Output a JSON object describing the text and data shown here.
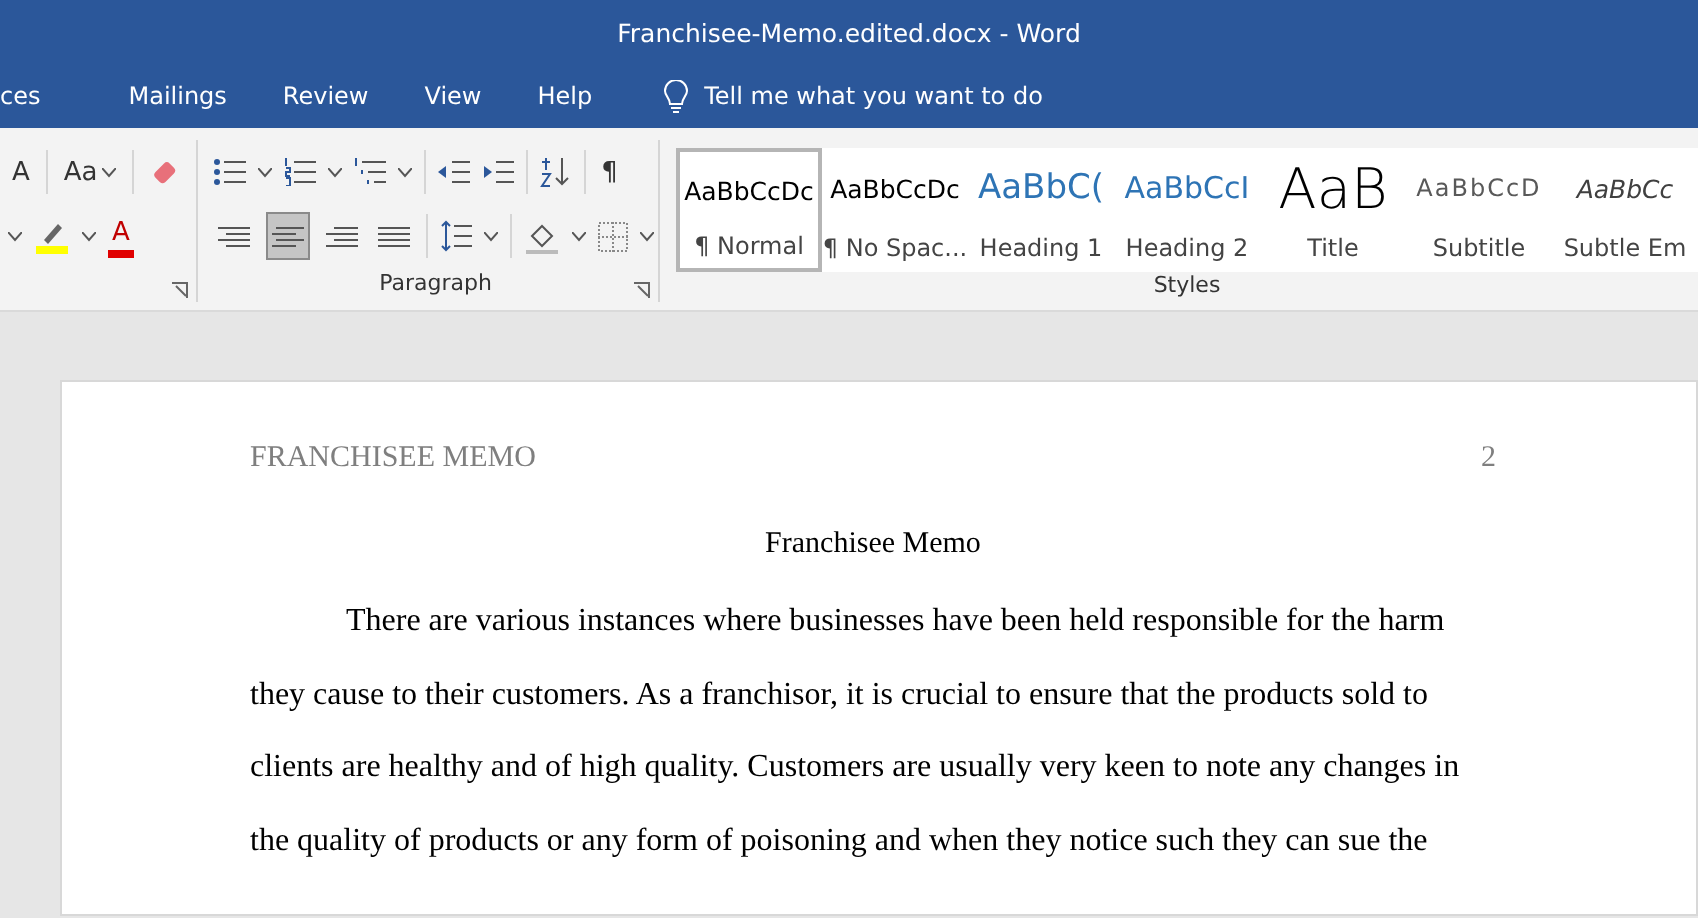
{
  "window": {
    "title": "Franchisee-Memo.edited.docx  -  Word"
  },
  "menu_tabs": [
    {
      "label": "ces",
      "selected": false
    },
    {
      "label": "Mailings",
      "selected": false
    },
    {
      "label": "Review",
      "selected": false
    },
    {
      "label": "View",
      "selected": false
    },
    {
      "label": "Help",
      "selected": false
    }
  ],
  "tell_me": {
    "placeholder": "Tell me what you want to do"
  },
  "font_group": {
    "grow_font": "A",
    "change_case": "Aa",
    "font_color": "A"
  },
  "paragraph_group": {
    "label": "Paragraph",
    "pilcrow": "¶",
    "alignment": [
      {
        "kind": "left",
        "selected": false
      },
      {
        "kind": "center",
        "selected": true
      },
      {
        "kind": "right",
        "selected": false
      },
      {
        "kind": "justify",
        "selected": false
      }
    ]
  },
  "styles_group": {
    "label": "Styles",
    "items": [
      {
        "preview": "AaBbCcDc",
        "name": "¶ Normal",
        "kind": "normal",
        "selected": true
      },
      {
        "preview": "AaBbCcDc",
        "name": "¶ No Spac...",
        "kind": "normal",
        "selected": false
      },
      {
        "preview": "AaBbC(",
        "name": "Heading 1",
        "kind": "heading1",
        "selected": false
      },
      {
        "preview": "AaBbCcI",
        "name": "Heading 2",
        "kind": "heading2",
        "selected": false
      },
      {
        "preview": "AaB",
        "name": "Title",
        "kind": "title",
        "selected": false
      },
      {
        "preview": "AaBbCcD",
        "name": "Subtitle",
        "kind": "subtitle",
        "selected": false
      },
      {
        "preview": "AaBbCc",
        "name": "Subtle Em",
        "kind": "emphasis",
        "selected": false
      }
    ]
  },
  "document": {
    "header": "FRANCHISEE MEMO",
    "page_number": "2",
    "title": "Franchisee Memo",
    "paragraph": "There are various instances where businesses have been held responsible for the harm they cause to their customers. As a franchisor, it is crucial to ensure that the products sold to clients are healthy and of high quality. Customers are usually very keen to note any changes in the quality of products or any form of poisoning and when they notice such they can sue the"
  }
}
